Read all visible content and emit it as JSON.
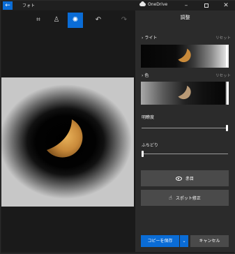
{
  "titlebar": {
    "app_title": "フォト",
    "onedrive_label": "OneDrive",
    "minimize": "–",
    "close": "✕"
  },
  "toolbar": {
    "crop_icon": "⌗",
    "filter_icon": "♙",
    "adjust_icon": "✺",
    "undo_icon": "↶",
    "redo_icon": "↷"
  },
  "panel": {
    "title": "調整",
    "light": {
      "label": "ライト",
      "reset": "リセット"
    },
    "color": {
      "label": "色",
      "reset": "リセット"
    },
    "clarity": {
      "label": "明瞭度",
      "value": 1.0
    },
    "vignette": {
      "label": "ふちどり",
      "value": 0.0
    },
    "red_eye_button": "赤目",
    "spot_fix_button": "スポット修正",
    "save_copy_button": "コピーを保存",
    "save_dropdown": "⌄",
    "cancel_button": "キャンセル"
  },
  "colors": {
    "accent": "#0a6cd6",
    "panel_bg": "#2b2b2b",
    "button_bg": "#4a4a4a"
  }
}
